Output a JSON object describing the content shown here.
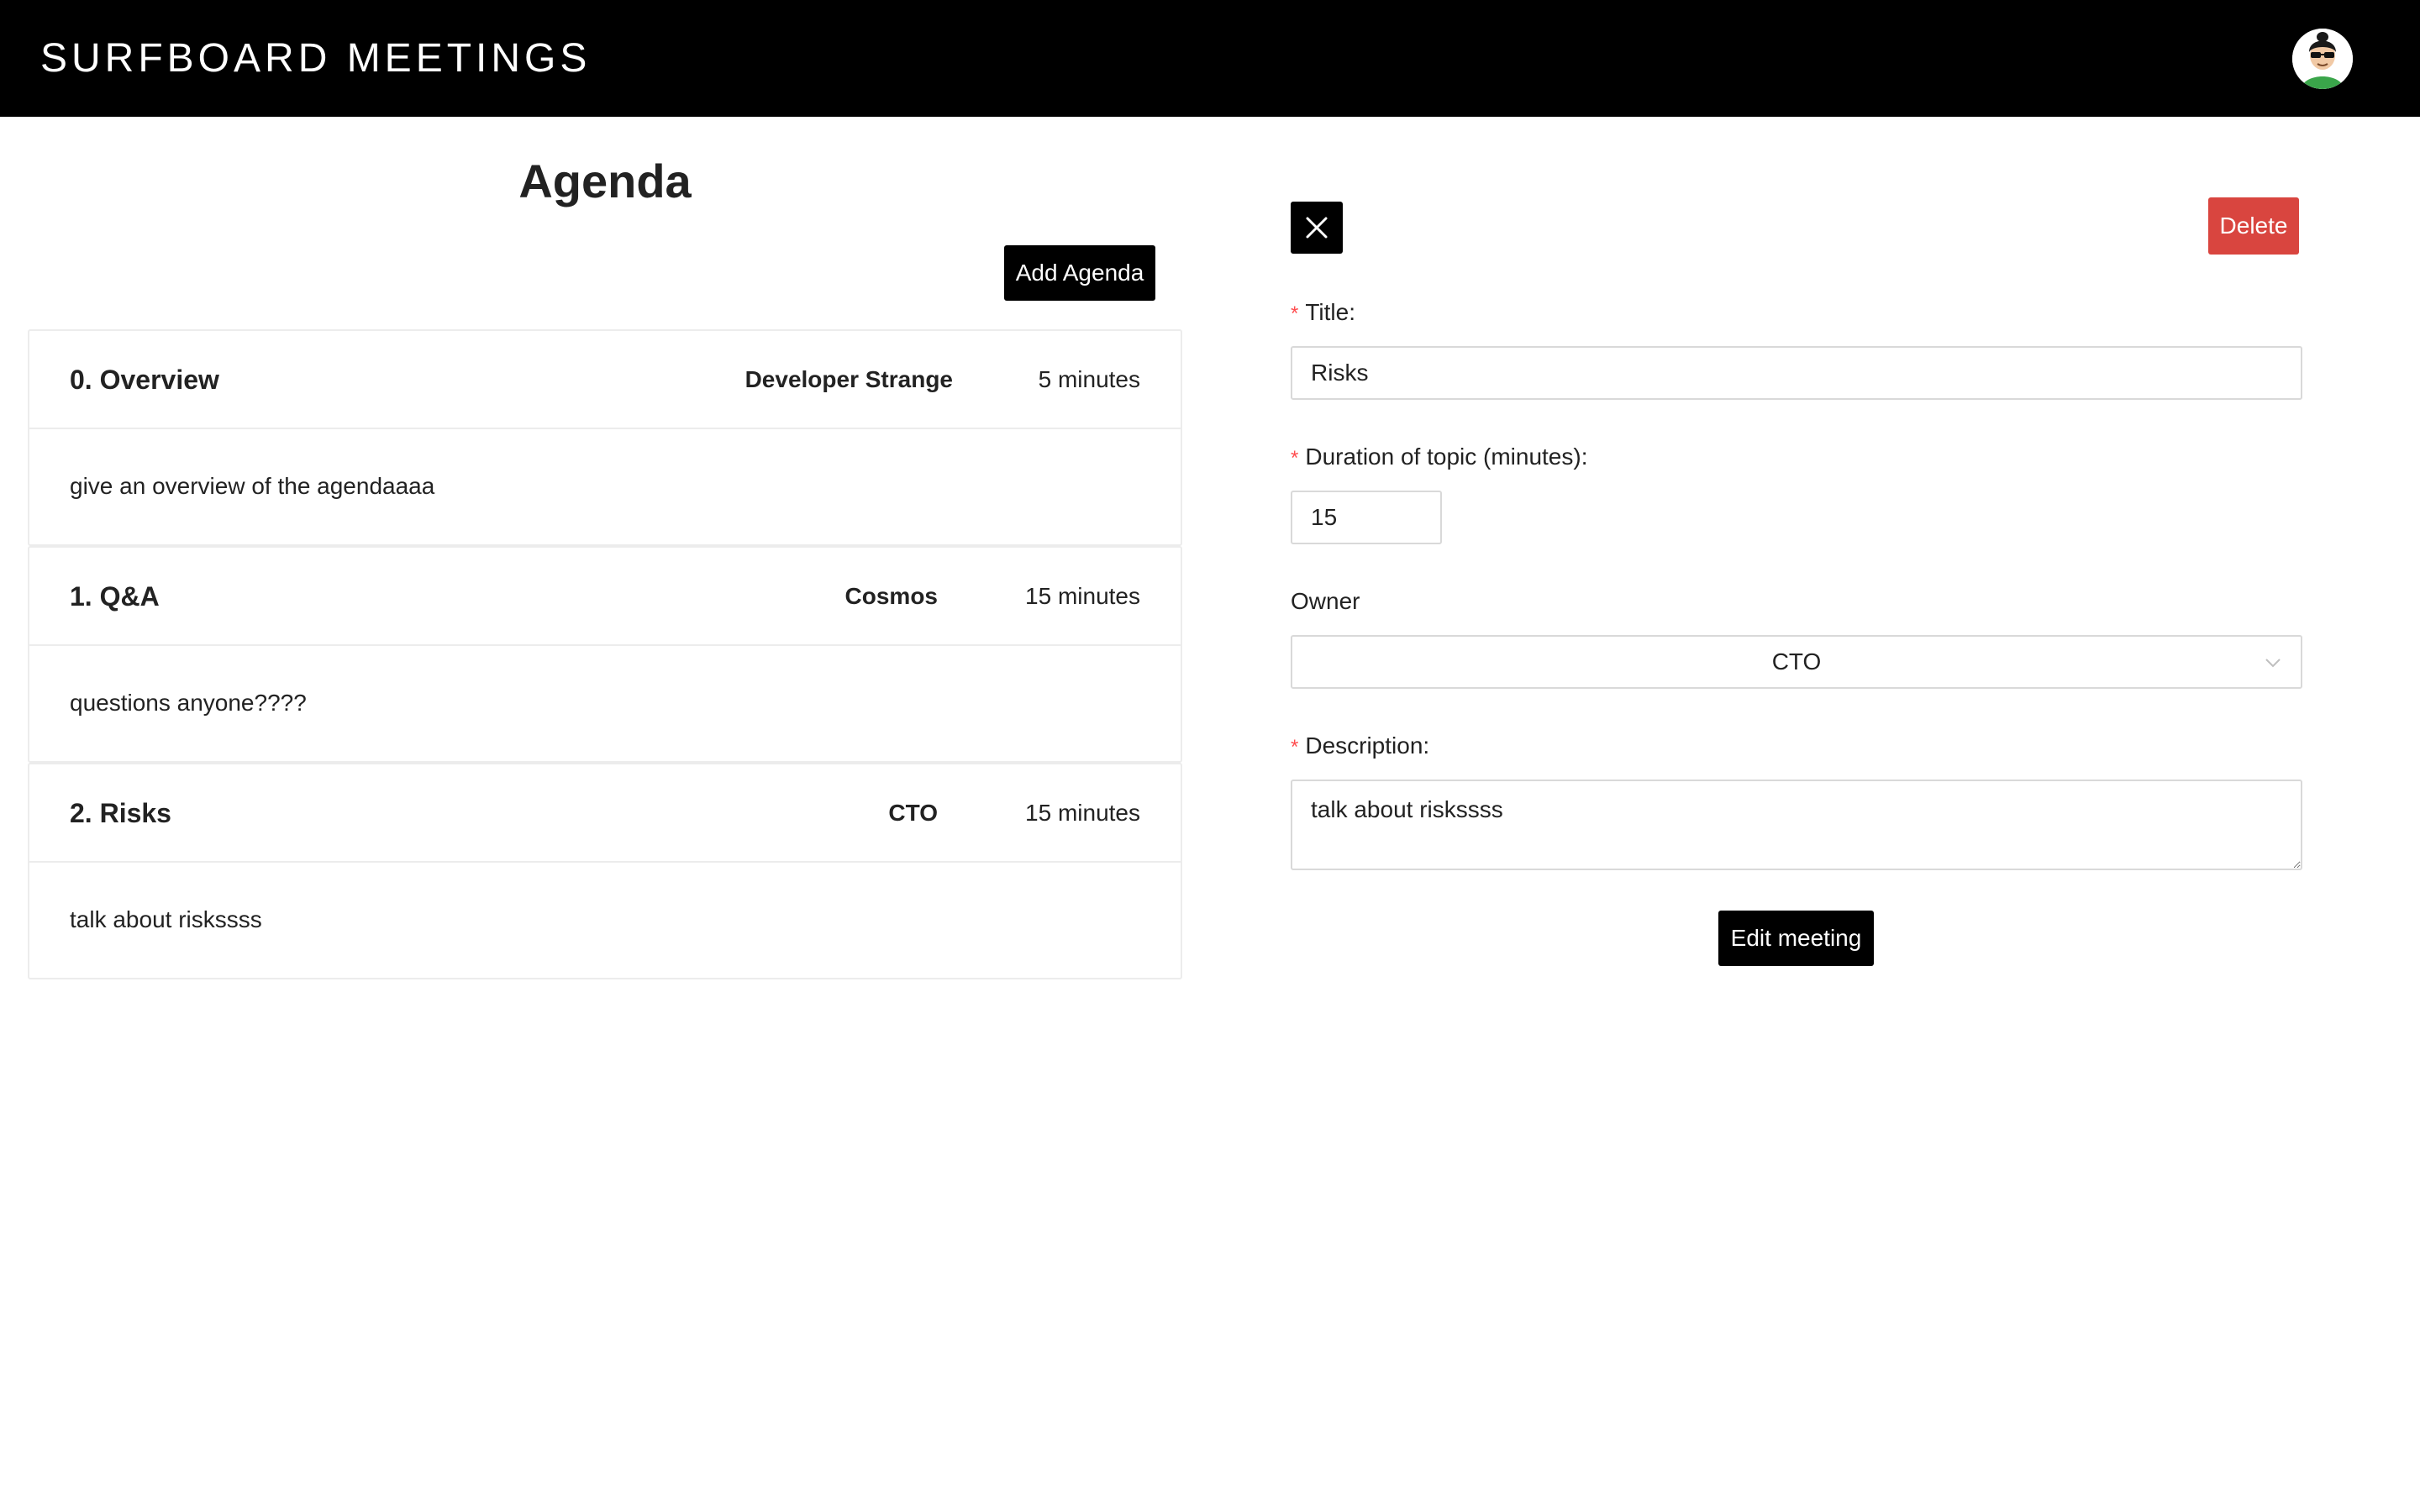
{
  "header": {
    "brand": "SURFBOARD MEETINGS",
    "avatar_icon": "user-avatar-icon"
  },
  "agenda": {
    "heading": "Agenda",
    "add_button": "Add Agenda",
    "items": [
      {
        "title": "0. Overview",
        "owner": "Developer Strange",
        "duration": "5 minutes",
        "description": "give an overview of the agendaaaa"
      },
      {
        "title": "1. Q&A",
        "owner": "Cosmos",
        "duration": "15 minutes",
        "description": "questions anyone????"
      },
      {
        "title": "2. Risks",
        "owner": "CTO",
        "duration": "15 minutes",
        "description": "talk about riskssss"
      }
    ]
  },
  "form": {
    "close_icon": "close-icon",
    "delete_button": "Delete",
    "required_mark": "*",
    "title_label": "Title:",
    "title_value": "Risks",
    "duration_label": "Duration of topic (minutes):",
    "duration_value": "15",
    "owner_label": "Owner",
    "owner_value": "CTO",
    "description_label": "Description:",
    "description_value": "talk about riskssss",
    "submit_button": "Edit meeting"
  },
  "colors": {
    "header_bg": "#000000",
    "delete_bg": "#d9453f",
    "required": "#ff4d4f",
    "border": "#d9d9d9"
  }
}
